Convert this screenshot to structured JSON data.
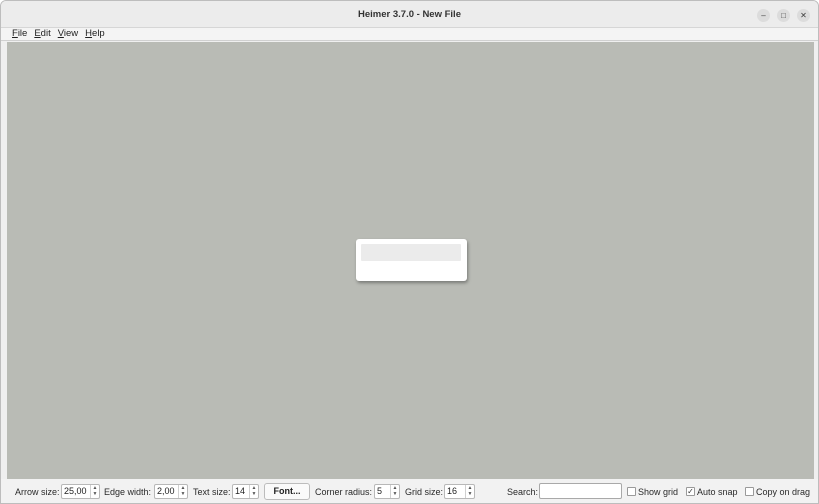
{
  "window": {
    "title": "Heimer 3.7.0 - New File",
    "controls": {
      "minimize": "–",
      "maximize": "□",
      "close": "✕"
    }
  },
  "menubar": {
    "items": [
      {
        "mnemonic": "F",
        "rest": "ile"
      },
      {
        "mnemonic": "E",
        "rest": "dit"
      },
      {
        "mnemonic": "V",
        "rest": "iew"
      },
      {
        "mnemonic": "H",
        "rest": "elp"
      }
    ]
  },
  "canvas": {
    "background": "#b9bbb5",
    "node_color": "#ffffff"
  },
  "toolbar": {
    "arrow_size": {
      "label": "Arrow size:",
      "value": "25,00"
    },
    "edge_width": {
      "label": "Edge width:",
      "value": "2,00"
    },
    "text_size": {
      "label": "Text size:",
      "value": "14"
    },
    "font_button": "Font...",
    "corner_radius": {
      "label": "Corner radius:",
      "value": "5"
    },
    "grid_size": {
      "label": "Grid size:",
      "value": "16"
    },
    "search": {
      "label": "Search:",
      "value": ""
    },
    "show_grid": {
      "label": "Show grid",
      "checked": false
    },
    "auto_snap": {
      "label": "Auto snap",
      "checked": true,
      "mark": "✓"
    },
    "copy_on_drag": {
      "label": "Copy on drag",
      "checked": false
    },
    "spin_up": "▲",
    "spin_down": "▼"
  }
}
